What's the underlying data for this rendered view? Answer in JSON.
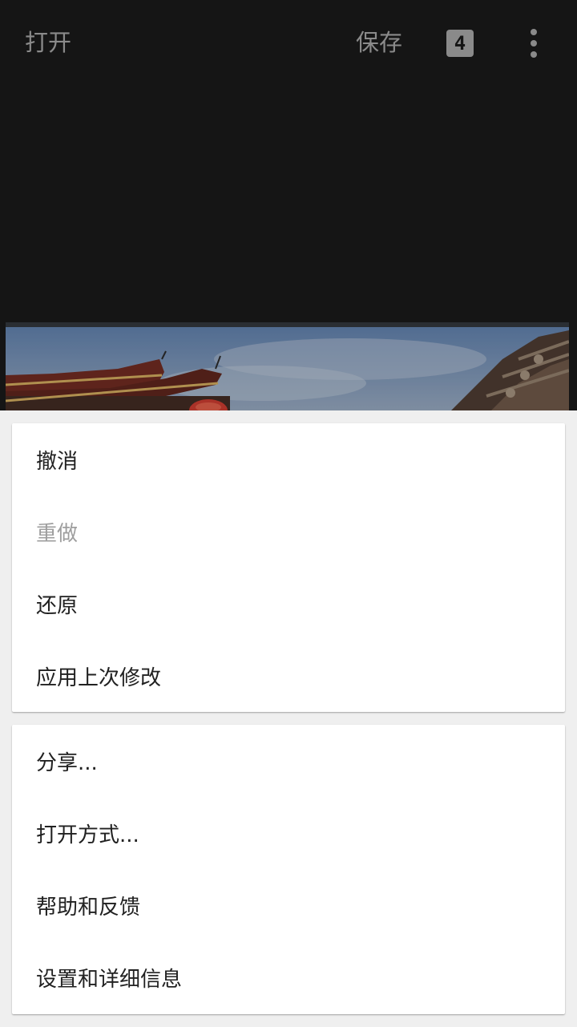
{
  "toolbar": {
    "open_label": "打开",
    "save_label": "保存",
    "badge_value": "4",
    "more_icon": "more-vert-icon"
  },
  "photo": {
    "description_icon": "photo-preview"
  },
  "menu": {
    "group1": [
      {
        "label": "撤消",
        "enabled": true
      },
      {
        "label": "重做",
        "enabled": false
      },
      {
        "label": "还原",
        "enabled": true
      },
      {
        "label": "应用上次修改",
        "enabled": true
      }
    ],
    "group2": [
      {
        "label": "分享...",
        "enabled": true
      },
      {
        "label": "打开方式...",
        "enabled": true
      },
      {
        "label": "帮助和反馈",
        "enabled": true
      },
      {
        "label": "设置和详细信息",
        "enabled": true
      }
    ]
  },
  "colors": {
    "toolbar_bg": "#151515",
    "dim_text": "#8a8a8a",
    "sheet_bg": "#efefef",
    "card_bg": "#ffffff",
    "item_text": "#212121",
    "disabled_text": "#9e9e9e"
  }
}
